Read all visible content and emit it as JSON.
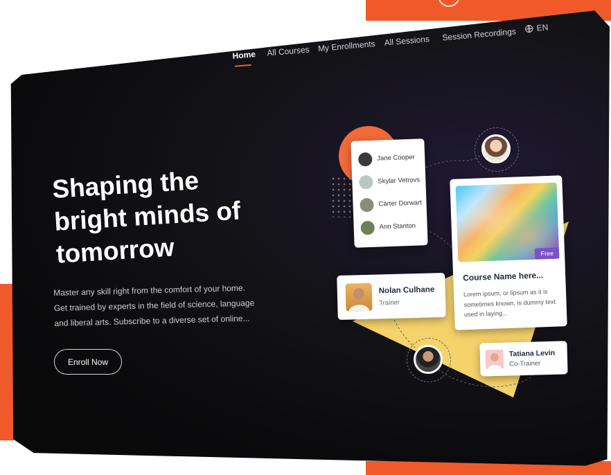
{
  "nav": {
    "items": [
      {
        "label": "Home",
        "active": true
      },
      {
        "label": "All Courses",
        "active": false
      },
      {
        "label": "My Enrollments",
        "active": false
      },
      {
        "label": "All Sessions",
        "active": false
      },
      {
        "label": "Session Recordings",
        "active": false
      }
    ],
    "language": "EN"
  },
  "hero": {
    "title_line1": "Shaping the",
    "title_line2": "bright minds of",
    "title_line3": "tomorrow",
    "description": "Master any skill right from the comfort of your home. Get trained by experts in the field of science, language and liberal arts. Subscribe to a diverse set of online...",
    "cta": "Enroll Now"
  },
  "students": [
    {
      "name": "Jane Cooper",
      "avatar_color": "#3a3a3a"
    },
    {
      "name": "Skylar Vetrovs",
      "avatar_color": "#b9c7c2"
    },
    {
      "name": "Carter Dorwart",
      "avatar_color": "#8c8c7a"
    },
    {
      "name": "Ann Stanton",
      "avatar_color": "#6f7f5a"
    }
  ],
  "course": {
    "title": "Course Name here...",
    "description": "Lorem ipsum, or lipsum as it is sometimes known, is dummy text used in laying...",
    "badge": "Free"
  },
  "trainer": {
    "name": "Nolan Culhane",
    "role": "Trainer"
  },
  "cotrainer": {
    "name": "Tatiana Levin",
    "role": "Co-Trainer"
  },
  "colors": {
    "accent": "#f05a2b",
    "badge": "#7a52c7",
    "yellow": "#f6d26b",
    "background": "#0b0b0d"
  }
}
